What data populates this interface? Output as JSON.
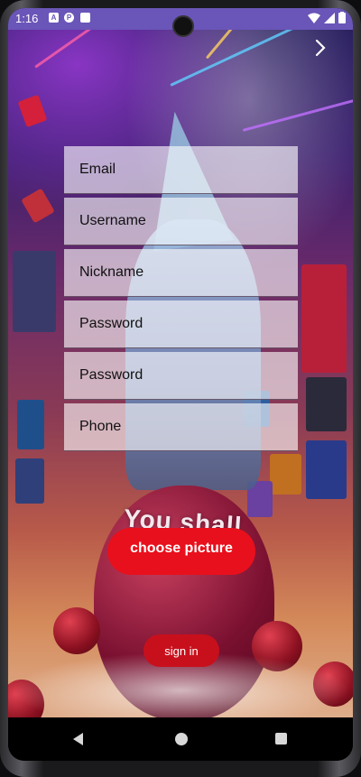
{
  "status_bar": {
    "time": "1:16",
    "notifications": [
      "A",
      "P"
    ]
  },
  "header": {
    "forward_icon": "chevron-right-icon"
  },
  "form": {
    "email_placeholder": "Email",
    "username_placeholder": "Username",
    "nickname_placeholder": "Nickname",
    "password_placeholder": "Password",
    "confirm_password_placeholder": "Password",
    "phone_placeholder": "Phone"
  },
  "background_text": "You shall",
  "buttons": {
    "choose_picture": "choose picture",
    "sign_in": "sign in"
  },
  "colors": {
    "status_bar": "#6a55b8",
    "button": "#e8101c"
  },
  "nav_bar": {
    "back_icon": "back-triangle-icon",
    "home_icon": "home-circle-icon",
    "recent_icon": "recent-square-icon"
  }
}
